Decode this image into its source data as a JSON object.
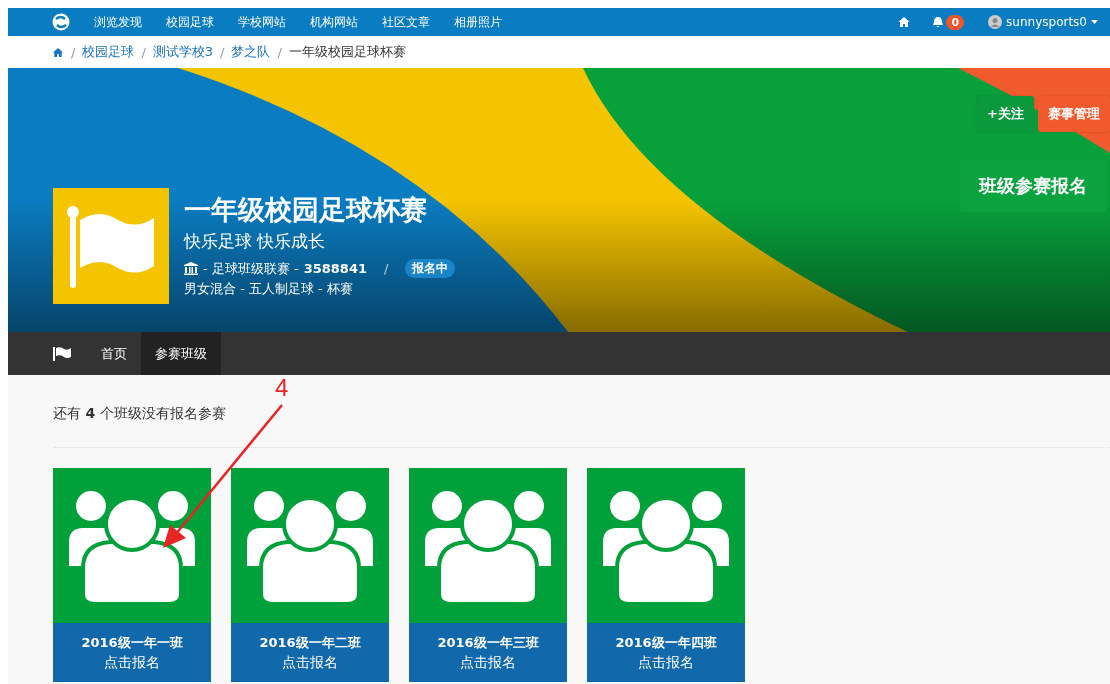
{
  "top_nav": {
    "items": [
      {
        "label": "浏览发现"
      },
      {
        "label": "校园足球"
      },
      {
        "label": "学校网站"
      },
      {
        "label": "机构网站"
      },
      {
        "label": "社区文章"
      },
      {
        "label": "相册照片"
      }
    ],
    "notifications": "0",
    "user": "sunnysports0"
  },
  "breadcrumb": [
    {
      "separator": "/",
      "label": "校园足球"
    },
    {
      "separator": "/",
      "label": "测试学校3"
    },
    {
      "separator": "/",
      "label": "梦之队"
    },
    {
      "separator": "/",
      "label": "一年级校园足球杯赛"
    }
  ],
  "banner": {
    "title": "一年级校园足球杯赛",
    "slogan": "快乐足球 快乐成长",
    "league": "- 足球班级联赛 -",
    "id": "3588841",
    "separator": "/",
    "status": "报名中",
    "tags": "男女混合 - 五人制足球 - 杯赛",
    "buttons": [
      {
        "label": "+关注",
        "kind": "follow"
      },
      {
        "label": "赛事管理",
        "kind": "manage"
      }
    ],
    "signup_button": "班级参赛报名"
  },
  "sub_nav": [
    {
      "label": "首页",
      "selected": false
    },
    {
      "label": "参赛班级",
      "selected": true
    }
  ],
  "notice": "还有 **4** 个班级没有报名参赛",
  "annotation": "4",
  "classes": [
    {
      "name": "2016级一年一班",
      "action": "点击报名"
    },
    {
      "name": "2016级一年二班",
      "action": "点击报名"
    },
    {
      "name": "2016级一年三班",
      "action": "点击报名"
    },
    {
      "name": "2016级一年四班",
      "action": "点击报名"
    }
  ]
}
